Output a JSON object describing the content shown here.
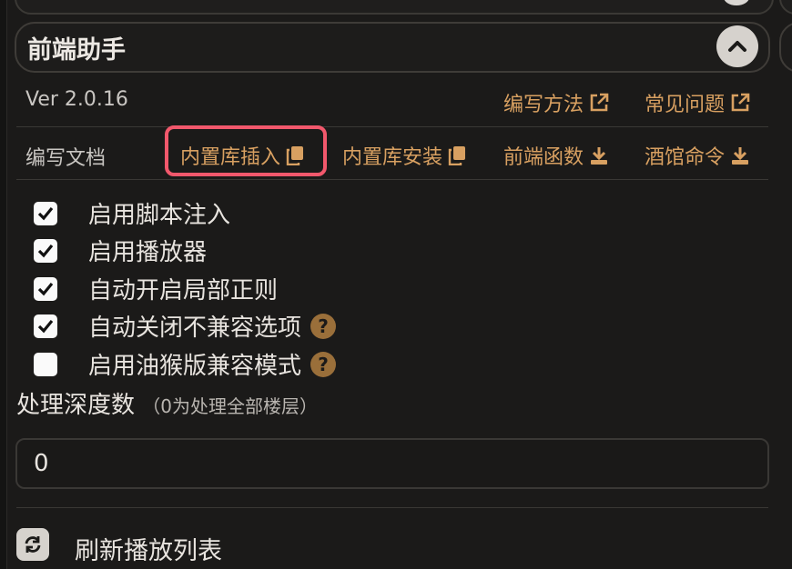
{
  "panel": {
    "title": "前端助手",
    "version": "Ver 2.0.16"
  },
  "links": {
    "write_method": "编写方法",
    "faq": "常见问题"
  },
  "docs": {
    "label": "编写文档",
    "builtin_insert": "内置库插入",
    "builtin_install": "内置库安装",
    "frontend_functions": "前端函数",
    "tavern_commands": "酒馆命令"
  },
  "options": [
    {
      "label": "启用脚本注入",
      "checked": true
    },
    {
      "label": "启用播放器",
      "checked": true
    },
    {
      "label": "自动开启局部正则",
      "checked": true
    },
    {
      "label": "自动关闭不兼容选项",
      "checked": true,
      "help": "?"
    },
    {
      "label": "启用油猴版兼容模式",
      "checked": false,
      "help": "?"
    }
  ],
  "depth": {
    "label": "处理深度数",
    "hint": "（0为处理全部楼层）",
    "value": "0"
  },
  "refresh": {
    "label": "刷新播放列表"
  },
  "colors": {
    "accent": "#d8a061",
    "highlight": "#f2586c",
    "background": "#1b1a19"
  }
}
